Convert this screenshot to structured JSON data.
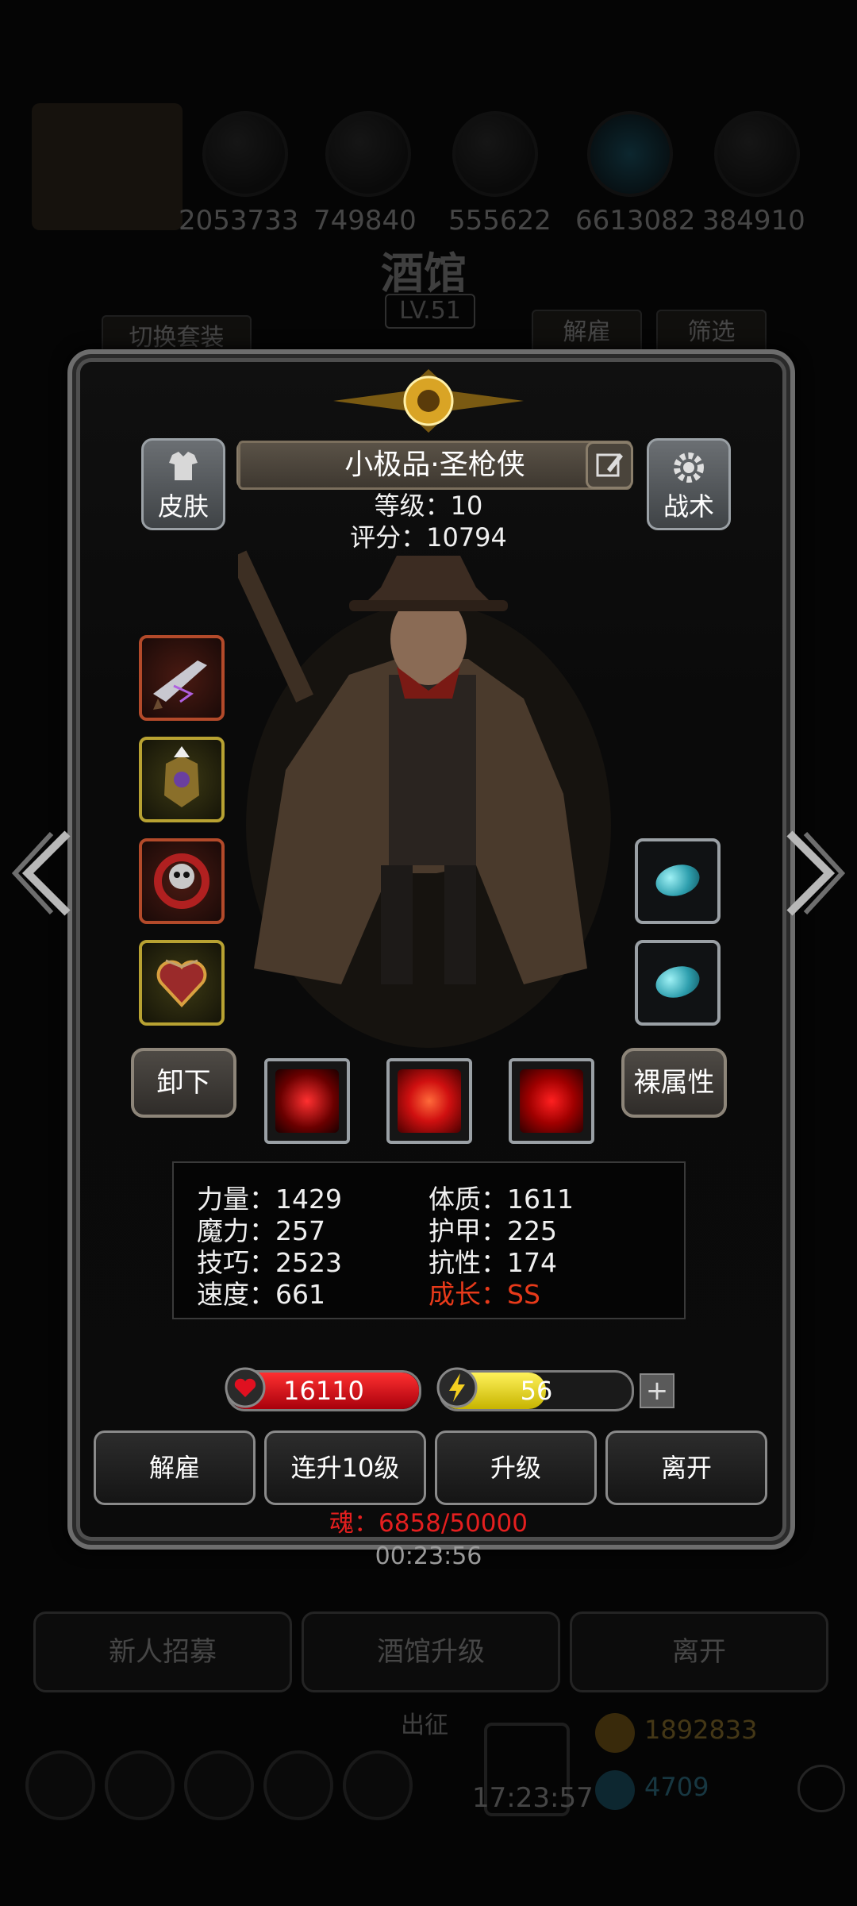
{
  "background": {
    "resources": [
      "2053733",
      "749840",
      "555622",
      "6613082",
      "384910"
    ],
    "title": "酒馆",
    "level": "LV.51",
    "buttons": {
      "switch_outfit": "切换套装",
      "dismiss": "解雇",
      "filter": "筛选"
    },
    "bottom_buttons": [
      "新人招募",
      "酒馆升级",
      "离开"
    ],
    "expedition_label": "出征",
    "gold": "1892833",
    "gems": "4709",
    "clock": "17:23:57"
  },
  "hero": {
    "name": "小极品·圣枪侠",
    "level_text": "等级：10",
    "score_text": "评分：10794",
    "skin_label": "皮肤",
    "tactics_label": "战术",
    "unequip_label": "卸下",
    "base_attr_label": "裸属性"
  },
  "stats": {
    "strength": "力量：1429",
    "constitution": "体质：1611",
    "magic": "魔力：257",
    "armor": "护甲：225",
    "skill": "技巧：2523",
    "resistance": "抗性：174",
    "speed": "速度：661",
    "growth": "成长：SS"
  },
  "bars": {
    "hp": "16110",
    "energy": "56",
    "energy_fill": 0.55,
    "plus": "+"
  },
  "actions": {
    "dismiss": "解雇",
    "level_up_10": "连升10级",
    "level_up": "升级",
    "leave": "离开"
  },
  "soul_text": "魂：6858/50000",
  "timer": "00:23:56",
  "colors": {
    "accent_red": "#e41f1f",
    "hp_red": "#c8101a",
    "energy_yellow": "#e8dd1a",
    "gem_cyan": "#2e9fae"
  }
}
